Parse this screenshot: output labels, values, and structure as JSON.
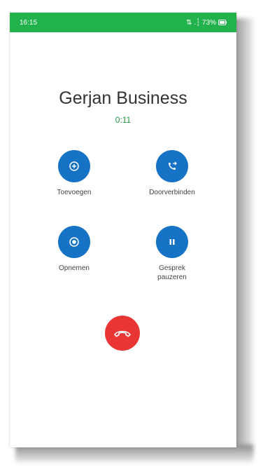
{
  "status_bar": {
    "time": "16:15",
    "indicators": "⇅ .┆ 73%",
    "battery_icon": "battery-icon",
    "color": "#22b24c"
  },
  "call": {
    "caller_name": "Gerjan Business",
    "duration": "0:11"
  },
  "actions": [
    {
      "label": "Toevoegen",
      "icon": "add-call-icon"
    },
    {
      "label": "Doorverbinden",
      "icon": "transfer-call-icon"
    },
    {
      "label": "Opnemen",
      "icon": "record-icon"
    },
    {
      "label": "Gesprek\npauzeren",
      "icon": "pause-icon"
    }
  ],
  "hangup": {
    "icon": "end-call-icon",
    "color": "#ea3535"
  },
  "colors": {
    "accent": "#1672c4",
    "timer": "#1f9a3c"
  }
}
